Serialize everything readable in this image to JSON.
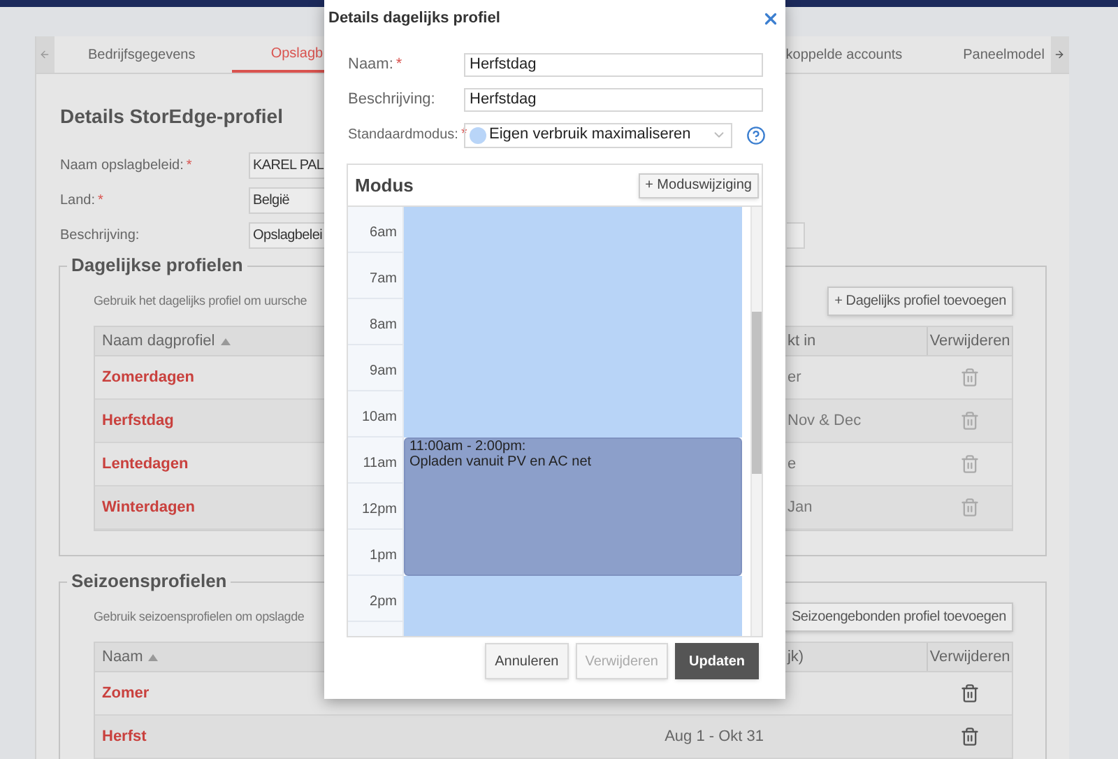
{
  "tabs": [
    {
      "label": "Bedrijfsgegevens",
      "selected": false
    },
    {
      "label": "Opslagb",
      "selected": true
    },
    {
      "label": "koppelde accounts",
      "selected": false
    },
    {
      "label": "Paneelmodel",
      "selected": false
    }
  ],
  "title": "Details StorEdge-profiel",
  "fields": [
    {
      "label": "Naam opslagbeleid:",
      "mark": "*",
      "value": "KAREL PAL"
    },
    {
      "label": "Land:",
      "mark": "*",
      "value": "België"
    },
    {
      "label": "Beschrijving:",
      "value": "Opslagbelei"
    }
  ],
  "daily": {
    "legend": "Dagelijkse profielen",
    "description": "Gebruik het dagelijks profiel om uursche",
    "add_button": "+ Dagelijks profiel toevoegen",
    "columns": [
      "Naam dagprofiel",
      "kt in",
      "Verwijderen"
    ],
    "rows": [
      {
        "name": "Zomerdagen",
        "column_2": "er"
      },
      {
        "name": "Herfstdag",
        "column_2": "Nov & Dec"
      },
      {
        "name": "Lentedagen",
        "column_2": "e"
      },
      {
        "name": "Winterdagen",
        "column_2": "Jan"
      }
    ]
  },
  "seasonal": {
    "legend": "Seizoensprofielen",
    "description": "Gebruik seizoensprofielen om opslagde",
    "add_button": "Seizoengebonden profiel toevoegen",
    "columns": [
      "Naam",
      "jk)",
      "Verwijderen"
    ],
    "rows": [
      {
        "name": "Zomer"
      },
      {
        "name": "Herfst",
        "column_2": "Aug 1 - Okt 31"
      }
    ]
  },
  "dialog": {
    "title": "Details dagelijks profiel",
    "fields": [
      {
        "label": "Naam:",
        "mark": "*",
        "value": "Herfstdag"
      },
      {
        "label": "Beschrijving:",
        "value": "Herfstdag"
      }
    ],
    "mode_field": {
      "label": "Standaardmodus:",
      "mark": "*",
      "value": "Eigen verbruik maximaliseren",
      "color": "#b9d5f8"
    },
    "modus": {
      "title": "Modus",
      "add_button": "+ Moduswijziging",
      "hours": [
        {
          "label": "6am",
          "kind": "default"
        },
        {
          "label": "7am",
          "kind": "default"
        },
        {
          "label": "8am",
          "kind": "default"
        },
        {
          "label": "9am",
          "kind": "default"
        },
        {
          "label": "10am",
          "kind": "default"
        },
        {
          "label": "11am",
          "kind": "charge",
          "time": "11:00am - 2:00pm:",
          "text": "Opladen vanuit PV en AC net"
        },
        {
          "label": "12pm",
          "kind": "charge"
        },
        {
          "label": "1pm",
          "kind": "charge"
        },
        {
          "label": "2pm",
          "kind": "default"
        }
      ]
    },
    "buttons": [
      {
        "label": "Annuleren",
        "kind": "default",
        "disabled": false
      },
      {
        "label": "Verwijderen",
        "kind": "default",
        "disabled": true
      },
      {
        "label": "Updaten",
        "kind": "primary",
        "disabled": false
      }
    ]
  }
}
